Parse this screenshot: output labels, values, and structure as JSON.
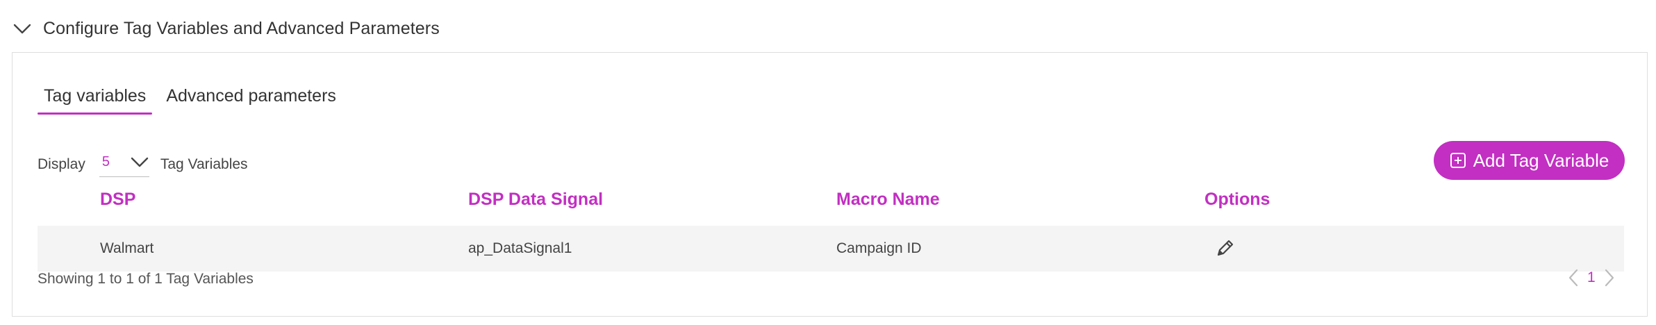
{
  "section": {
    "title": "Configure Tag Variables and Advanced Parameters",
    "toggle_icon": "chevron-down-icon"
  },
  "tabs": [
    {
      "label": "Tag variables",
      "active": true
    },
    {
      "label": "Advanced parameters",
      "active": false
    }
  ],
  "display": {
    "prefix": "Display",
    "value": "5",
    "suffix": "Tag Variables"
  },
  "add_button": {
    "label": "Add Tag Variable",
    "icon": "plus-square-icon"
  },
  "table": {
    "columns": [
      "DSP",
      "DSP Data Signal",
      "Macro Name",
      "Options"
    ],
    "rows": [
      {
        "dsp": "Walmart",
        "signal": "ap_DataSignal1",
        "macro": "Campaign ID",
        "option_icon": "pencil-icon"
      }
    ]
  },
  "footer": {
    "showing": "Showing 1 to 1 of 1 Tag Variables",
    "current_page": "1"
  },
  "colors": {
    "accent": "#c22fc2",
    "row_bg": "#f4f4f4",
    "border": "#dedede"
  }
}
